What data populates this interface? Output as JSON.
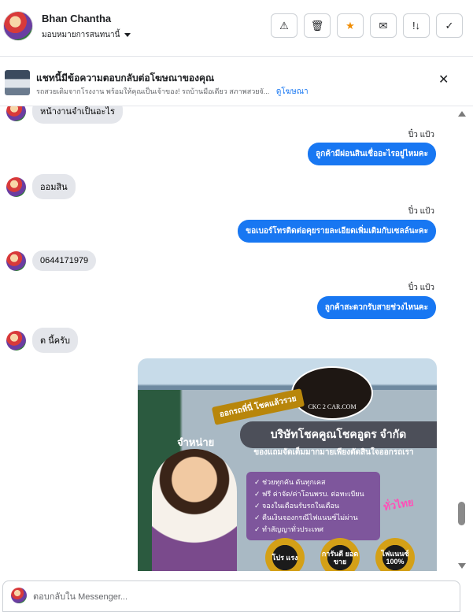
{
  "header": {
    "user_name": "Bhan Chantha",
    "assign_label": "มอบหมายการสนทนานี้",
    "actions": [
      {
        "icon": "warning-icon",
        "glyph": "⚠"
      },
      {
        "icon": "trash-icon",
        "glyph": "🗑"
      },
      {
        "icon": "star-icon",
        "glyph": "★"
      },
      {
        "icon": "mark-read-icon",
        "glyph": "✉"
      },
      {
        "icon": "follow-up-icon",
        "glyph": "!↓"
      },
      {
        "icon": "done-icon",
        "glyph": "✓"
      }
    ],
    "accent_color": "#f08c00"
  },
  "ad_banner": {
    "title": "แชทนี้มีข้อความตอบกลับต่อโฆษณาของคุณ",
    "description": "รถสวยเดิมจากโรงงาน พร้อมให้คุณเป็นเจ้าของ! รถบ้านมือเดียว สภาพสวยจั...",
    "link": "ดูโฆษณา",
    "close_glyph": "✕"
  },
  "thread": {
    "messages": [
      {
        "direction": "in",
        "text": "หน้างานจำเป็นอะไร"
      },
      {
        "direction": "out",
        "sender": "ปิ๋ว แป้ว",
        "text": "ลูกค้ามีผ่อนสินเชื่ออะไรอยู่ไหมคะ"
      },
      {
        "direction": "in",
        "text": "ออมสิน"
      },
      {
        "direction": "out",
        "sender": "ปิ๋ว แป้ว",
        "text": "ขอเบอร์โทรติดต่อคุยรายละเอียดเพิ่มเติมกับเซลล์นะคะ"
      },
      {
        "direction": "in",
        "text": "0644171979"
      },
      {
        "direction": "out",
        "sender": "ปิ๋ว แป้ว",
        "text": "ลูกค้าสะดวกรับสายช่วงไหนคะ"
      },
      {
        "direction": "in",
        "text": "ต นี้ครับ"
      }
    ],
    "image_ad": {
      "logo_text": "CKC 2 CAR.COM",
      "badge": "ออกรถที่นี่ โชคแล้วรวย",
      "side_sign": "จำหน่าย",
      "company": "บริษัทโชคคูณโชคอูดร จำกัด",
      "tagline": "ของแถมจัดเต็มมากมายเพียงตัดสินใจออกรถเรา",
      "bullets": [
        "✓ ช่วยทุกคัน ดันทุกเคส",
        "✓ ฟรี ค่าจัด/ค่าโอนพรบ. ต่อทะเบียน",
        "✓ จองในเดือนรับรถในเดือน",
        "✓ คืนเงินจองกรณีไฟแนนซ์ไม่ผ่าน",
        "✓ ทำสัญญาทั่วประเทศ"
      ],
      "region_text": "ทั่วไทย",
      "seals": [
        "โปร แรง",
        "การันตี ยอดขาย",
        "ไฟแนนซ์ 100%"
      ]
    }
  },
  "composer": {
    "placeholder": "ตอบกลับใน Messenger..."
  },
  "scrollbar": {
    "position": 0.92
  }
}
